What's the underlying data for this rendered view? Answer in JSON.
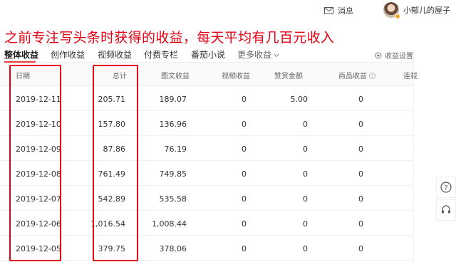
{
  "header": {
    "messages_label": "消息",
    "username": "小郁儿的屋子"
  },
  "annotation": {
    "headline": "之前专注写头条时获得的收益，每天平均有几百元收入"
  },
  "tabs": [
    {
      "label": "整体收益",
      "active": true
    },
    {
      "label": "创作收益"
    },
    {
      "label": "视频收益"
    },
    {
      "label": "付费专栏"
    },
    {
      "label": "番茄小说"
    },
    {
      "label": "更多收益"
    }
  ],
  "settings_label": "收益设置",
  "table": {
    "headers": [
      "日期",
      "总计",
      "图文收益",
      "视频收益",
      "赞赏金额",
      "商品收益",
      "连载"
    ],
    "rows": [
      [
        "2019-12-11",
        "205.71",
        "189.07",
        "0",
        "5.00",
        "0"
      ],
      [
        "2019-12-10",
        "157.80",
        "136.96",
        "0",
        "0",
        "0"
      ],
      [
        "2019-12-09",
        "87.86",
        "76.19",
        "0",
        "0",
        "0"
      ],
      [
        "2019-12-08",
        "761.49",
        "749.85",
        "0",
        "0",
        "0"
      ],
      [
        "2019-12-07",
        "542.89",
        "535.58",
        "0",
        "0",
        "0"
      ],
      [
        "2019-12-06",
        "1,016.54",
        "1,008.44",
        "0",
        "0",
        "0"
      ],
      [
        "2019-12-05",
        "379.75",
        "378.06",
        "0",
        "0",
        "0"
      ]
    ]
  },
  "colors": {
    "accent": "#e60012",
    "tab_underline": "#ed4040"
  },
  "icons": {
    "messages": "mail-icon",
    "settings": "settings-icon",
    "help": "question-icon",
    "support": "headset-icon",
    "info": "info-icon",
    "dropdown": "chevron-down-icon"
  }
}
